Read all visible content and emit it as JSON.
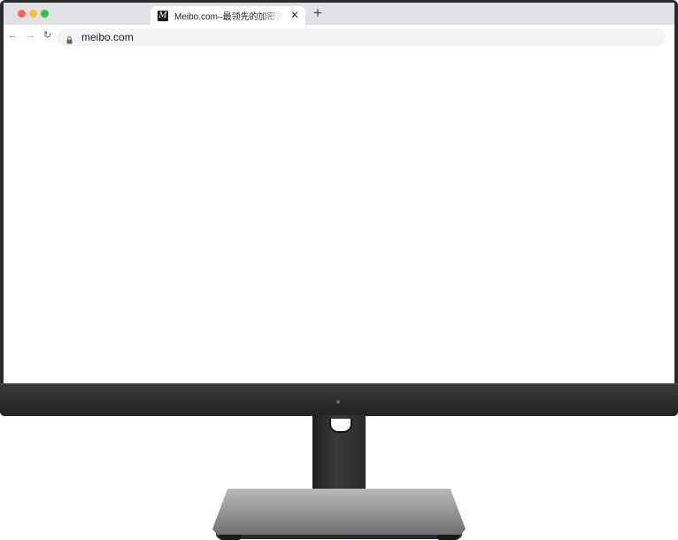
{
  "browser": {
    "tab": {
      "favicon_letter": "M",
      "title": "Meibo.com–最领先的加密货币",
      "close_glyph": "✕"
    },
    "new_tab_glyph": "+",
    "toolbar": {
      "back_glyph": "←",
      "forward_glyph": "→",
      "reload_glyph": "↻",
      "url": "meibo.com"
    }
  },
  "colors": {
    "close_button": "#ff5f57",
    "minimize_button": "#febc2e",
    "maximize_button": "#28c840",
    "bezel": "#2b2b2d",
    "stand_base": "#8e8e90"
  }
}
